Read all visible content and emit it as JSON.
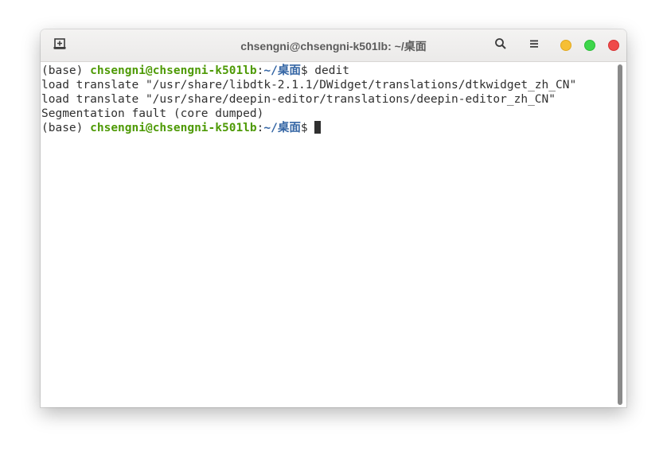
{
  "window": {
    "title": "chsengni@chsengni-k501lb: ~/桌面"
  },
  "titlebar": {
    "new_tab_icon": "new-tab-icon",
    "search_icon": "search-icon",
    "menu_icon": "hamburger-menu-icon",
    "buttons": {
      "minimize_color": "#f6bf35",
      "maximize_color": "#3ed64b",
      "close_color": "#ef4a4a"
    }
  },
  "terminal": {
    "env": "(base)",
    "user_host": "chsengni@chsengni-k501lb",
    "colon": ":",
    "path": "~/桌面",
    "prompt_symbol": "$",
    "command": " dedit",
    "output": [
      "load translate \"/usr/share/libdtk-2.1.1/DWidget/translations/dtkwidget_zh_CN\"",
      "load translate \"/usr/share/deepin-editor/translations/deepin-editor_zh_CN\"",
      "Segmentation fault (core dumped)"
    ],
    "colors": {
      "user_host": "#4e9a06",
      "path": "#3465a4",
      "text": "#303030"
    }
  }
}
